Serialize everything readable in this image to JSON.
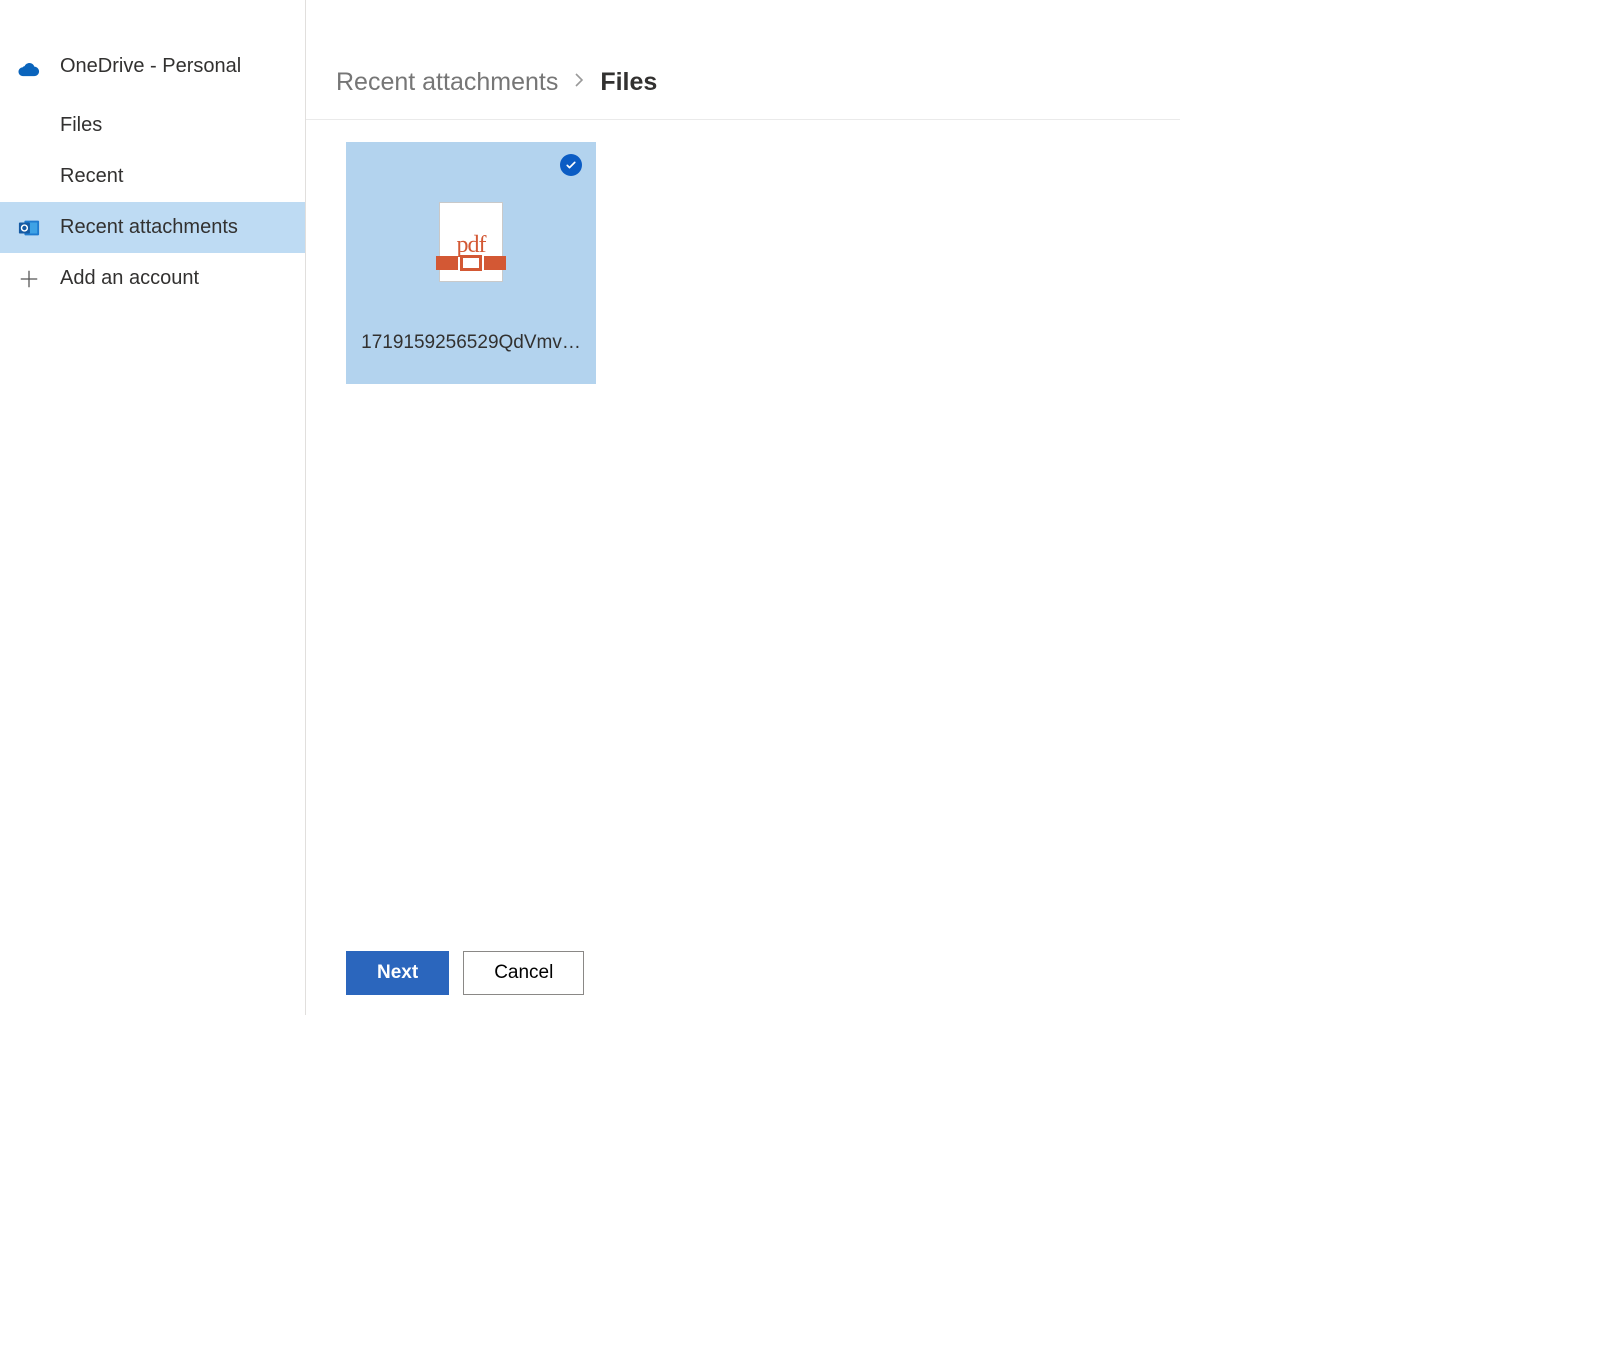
{
  "sidebar": {
    "account_label": "OneDrive - Personal",
    "items": [
      {
        "label": "Files"
      },
      {
        "label": "Recent"
      },
      {
        "label": "Recent attachments"
      },
      {
        "label": "Add an account"
      }
    ]
  },
  "breadcrumb": {
    "parent": "Recent attachments",
    "current": "Files"
  },
  "files": [
    {
      "name": "1719159256529QdVmv…",
      "type": "pdf",
      "selected": true
    }
  ],
  "pdf_icon_label": "pdf",
  "buttons": {
    "next": "Next",
    "cancel": "Cancel"
  }
}
